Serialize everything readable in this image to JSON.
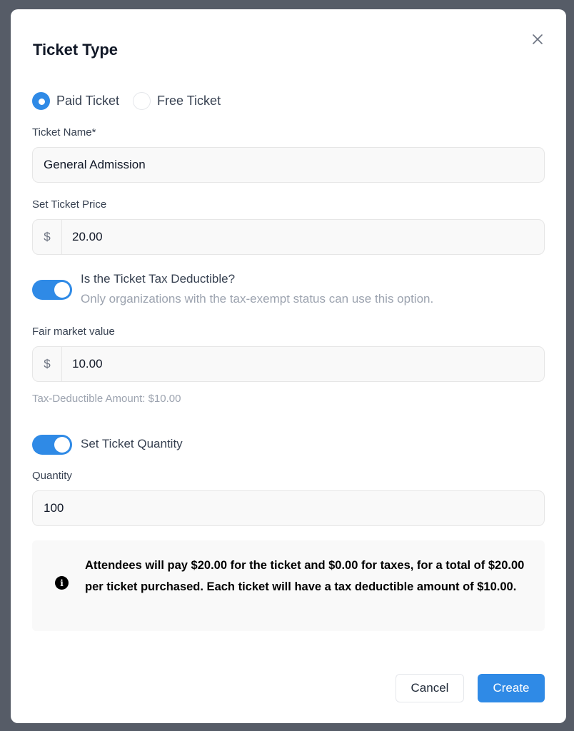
{
  "modal": {
    "title": "Ticket Type",
    "close_icon": "close-icon"
  },
  "ticket_kind": {
    "options": [
      {
        "label": "Paid Ticket",
        "selected": true
      },
      {
        "label": "Free Ticket",
        "selected": false
      }
    ]
  },
  "ticket_name": {
    "label": "Ticket Name*",
    "value": "General Admission"
  },
  "ticket_price": {
    "label": "Set Ticket Price",
    "currency_symbol": "$",
    "value": "20.00"
  },
  "tax_deductible": {
    "enabled": true,
    "title": "Is the Ticket Tax Deductible?",
    "subtitle": "Only organizations with the tax-exempt status can use this option."
  },
  "fair_market_value": {
    "label": "Fair market value",
    "currency_symbol": "$",
    "value": "10.00",
    "hint": "Tax-Deductible Amount: $10.00"
  },
  "ticket_quantity": {
    "enabled": true,
    "toggle_label": "Set Ticket Quantity",
    "label": "Quantity",
    "value": "100"
  },
  "summary": {
    "icon": "info-icon",
    "text": "Attendees will pay $20.00 for the ticket and $0.00 for taxes, for a total of $20.00 per ticket purchased. Each ticket will have a tax deductible amount of $10.00."
  },
  "footer": {
    "cancel_label": "Cancel",
    "create_label": "Create"
  },
  "colors": {
    "accent": "#2f8ae6",
    "backdrop": "#565c67"
  }
}
